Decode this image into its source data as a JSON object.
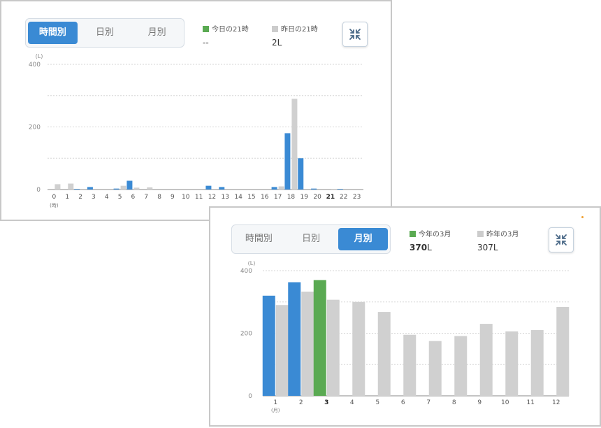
{
  "colors": {
    "today": "#3a8ad4",
    "current_highlight": "#5aaa52",
    "prev": "#d0d0d0",
    "legend_today": "#5aaa52",
    "legend_prev": "#cccccc",
    "tab_active": "#3a8ad4"
  },
  "icons": {
    "collapse": "collapse-arrows-icon"
  },
  "hourly": {
    "tabs": [
      "時間別",
      "日別",
      "月別"
    ],
    "active_tab": 0,
    "legend": {
      "current_label": "今日の21時",
      "current_value": "--",
      "prev_label": "昨日の21時",
      "prev_value": "2",
      "prev_unit": "L"
    }
  },
  "monthly": {
    "tabs": [
      "時間別",
      "日別",
      "月別"
    ],
    "active_tab": 2,
    "legend": {
      "current_label": "今年の3月",
      "current_value": "370",
      "current_unit": "L",
      "prev_label": "昨年の3月",
      "prev_value": "307",
      "prev_unit": "L"
    }
  },
  "chart_data": [
    {
      "type": "bar",
      "unit_label": "(L)",
      "x_unit_label": "(時)",
      "categories": [
        "0",
        "1",
        "2",
        "3",
        "4",
        "5",
        "6",
        "7",
        "8",
        "9",
        "10",
        "11",
        "12",
        "13",
        "14",
        "15",
        "16",
        "17",
        "18",
        "19",
        "20",
        "21",
        "22",
        "23"
      ],
      "highlight_category": "21",
      "series": [
        {
          "values": [
            0,
            0,
            2,
            8,
            0,
            3,
            28,
            0,
            0,
            0,
            0,
            0,
            12,
            8,
            0,
            0,
            0,
            8,
            180,
            100,
            3,
            0,
            2,
            0
          ]
        },
        {
          "values": [
            17,
            19,
            0,
            0,
            0,
            12,
            6,
            7,
            0,
            0,
            0,
            0,
            0,
            0,
            0,
            0,
            0,
            10,
            290,
            0,
            0,
            2,
            0,
            0
          ]
        }
      ],
      "ylim": [
        0,
        400
      ],
      "yticks": [
        0,
        200,
        400
      ],
      "grid": true
    },
    {
      "type": "bar",
      "unit_label": "(L)",
      "x_unit_label": "(月)",
      "categories": [
        "1",
        "2",
        "3",
        "4",
        "5",
        "6",
        "7",
        "8",
        "9",
        "10",
        "11",
        "12"
      ],
      "highlight_category": "3",
      "series": [
        {
          "values": [
            320,
            363,
            370,
            null,
            null,
            null,
            null,
            null,
            null,
            null,
            null,
            null
          ]
        },
        {
          "values": [
            290,
            333,
            307,
            300,
            268,
            195,
            175,
            191,
            230,
            206,
            210,
            284
          ]
        }
      ],
      "ylim": [
        0,
        400
      ],
      "yticks": [
        0,
        200,
        400
      ],
      "grid": true
    }
  ]
}
